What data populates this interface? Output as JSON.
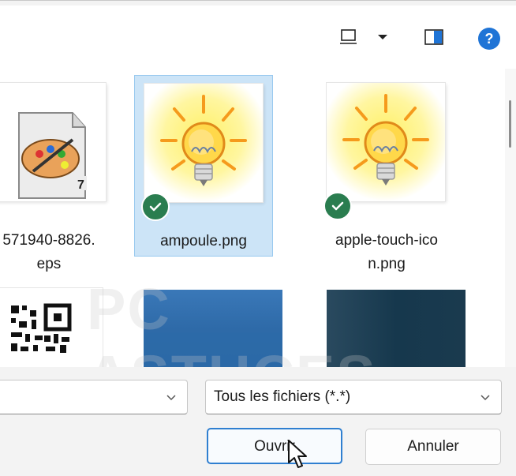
{
  "toolbar": {
    "view_icon": "view-mode-icon",
    "dropdown_icon": "dropdown-arrow-icon",
    "preview_icon": "preview-pane-icon",
    "help_icon": "help-icon",
    "help_glyph": "?"
  },
  "files": [
    {
      "name_line1": "571940-8826.",
      "name_line2": "eps",
      "icon": "eps-file-icon",
      "selected": false,
      "badge_text": "7"
    },
    {
      "name_line1": "ampoule.png",
      "name_line2": "",
      "icon": "light-bulb-thumbnail",
      "selected": true,
      "synced": true
    },
    {
      "name_line1": "apple-touch-ico",
      "name_line2": "n.png",
      "icon": "light-bulb-thumbnail",
      "selected": false,
      "synced": true
    }
  ],
  "second_row": [
    {
      "icon": "qr-code-thumbnail"
    },
    {
      "icon": "blue-gradient-thumbnail"
    },
    {
      "icon": "dark-gradient-thumbnail"
    }
  ],
  "filename_field": {
    "value": ""
  },
  "filetype": {
    "selected": "Tous les fichiers (*.*)"
  },
  "buttons": {
    "open": "Ouvrir",
    "cancel": "Annuler"
  },
  "colors": {
    "accent": "#2f7fd0",
    "selection_bg": "#cce4f7",
    "sync_green": "#2a7d4f",
    "help_blue": "#1f74d6"
  }
}
